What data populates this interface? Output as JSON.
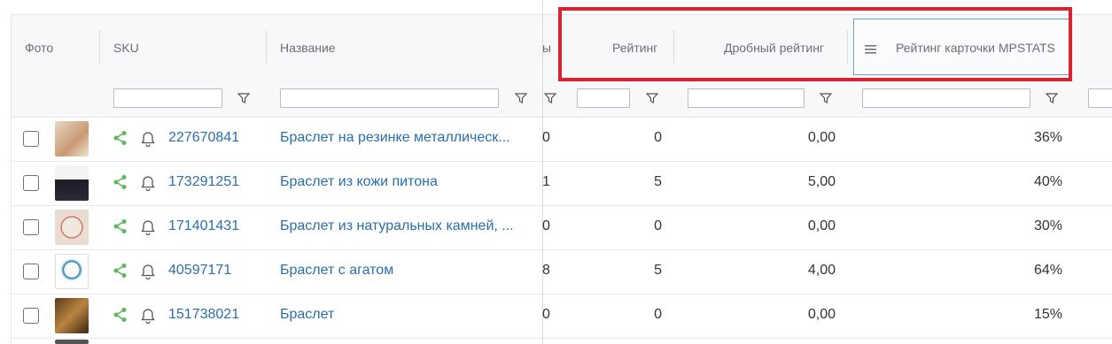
{
  "columns": {
    "photo": "Фото",
    "sku": "SKU",
    "name": "Название",
    "cut": "ы",
    "rating": "Рейтинг",
    "frac_rating": "Дробный рейтинг",
    "mpstats_rating": "Рейтинг карточки MPSTATS"
  },
  "rows": [
    {
      "sku": "227670841",
      "name": "Браслет на резинке металлическ...",
      "cut": "0",
      "rating": "0",
      "frac_rating": "0,00",
      "mpstats": "36%"
    },
    {
      "sku": "173291251",
      "name": "Браслет из кожи питона",
      "cut": "1",
      "rating": "5",
      "frac_rating": "5,00",
      "mpstats": "40%"
    },
    {
      "sku": "171401431",
      "name": "Браслет из натуральных камней, ...",
      "cut": "0",
      "rating": "0",
      "frac_rating": "0,00",
      "mpstats": "30%"
    },
    {
      "sku": "40597171",
      "name": "Браслет с агатом",
      "cut": "8",
      "rating": "5",
      "frac_rating": "4,00",
      "mpstats": "64%"
    },
    {
      "sku": "151738021",
      "name": "Браслет",
      "cut": "0",
      "rating": "0",
      "frac_rating": "0,00",
      "mpstats": "15%"
    }
  ],
  "colors": {
    "accent_link": "#2a6ead",
    "share_icon": "#5cb85c",
    "highlight_box": "#d9232e"
  },
  "icons": {
    "filter": "filter-icon",
    "share": "share-icon",
    "bell": "bell-icon",
    "menu": "menu-icon"
  }
}
